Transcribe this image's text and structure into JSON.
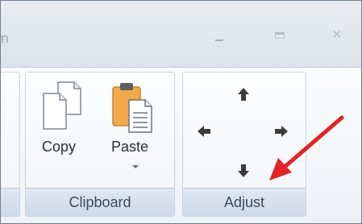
{
  "window": {
    "title_fragment": "n",
    "controls": [
      "minimize",
      "maximize",
      "close"
    ],
    "close_glyph": "✕"
  },
  "ribbon": {
    "groups": [
      {
        "id": "clipboard",
        "label": "Clipboard",
        "buttons": [
          {
            "label": "Copy",
            "icon": "copy-icon"
          },
          {
            "label": "Paste",
            "icon": "paste-icon",
            "has_dropdown": true
          }
        ]
      },
      {
        "id": "adjust",
        "label": "Adjust",
        "buttons": [
          {
            "icon": "arrow-up-icon"
          },
          {
            "icon": "arrow-left-icon"
          },
          {
            "icon": "arrow-right-icon"
          },
          {
            "icon": "arrow-down-icon"
          }
        ]
      }
    ]
  },
  "annotation": {
    "icon": "red-pointer-arrow",
    "color": "#e02424"
  },
  "colors": {
    "arrow_icons": "#3b3b3b",
    "paste_clipboard": "#f1a94a",
    "group_footer_text": "#3a4a5c"
  }
}
